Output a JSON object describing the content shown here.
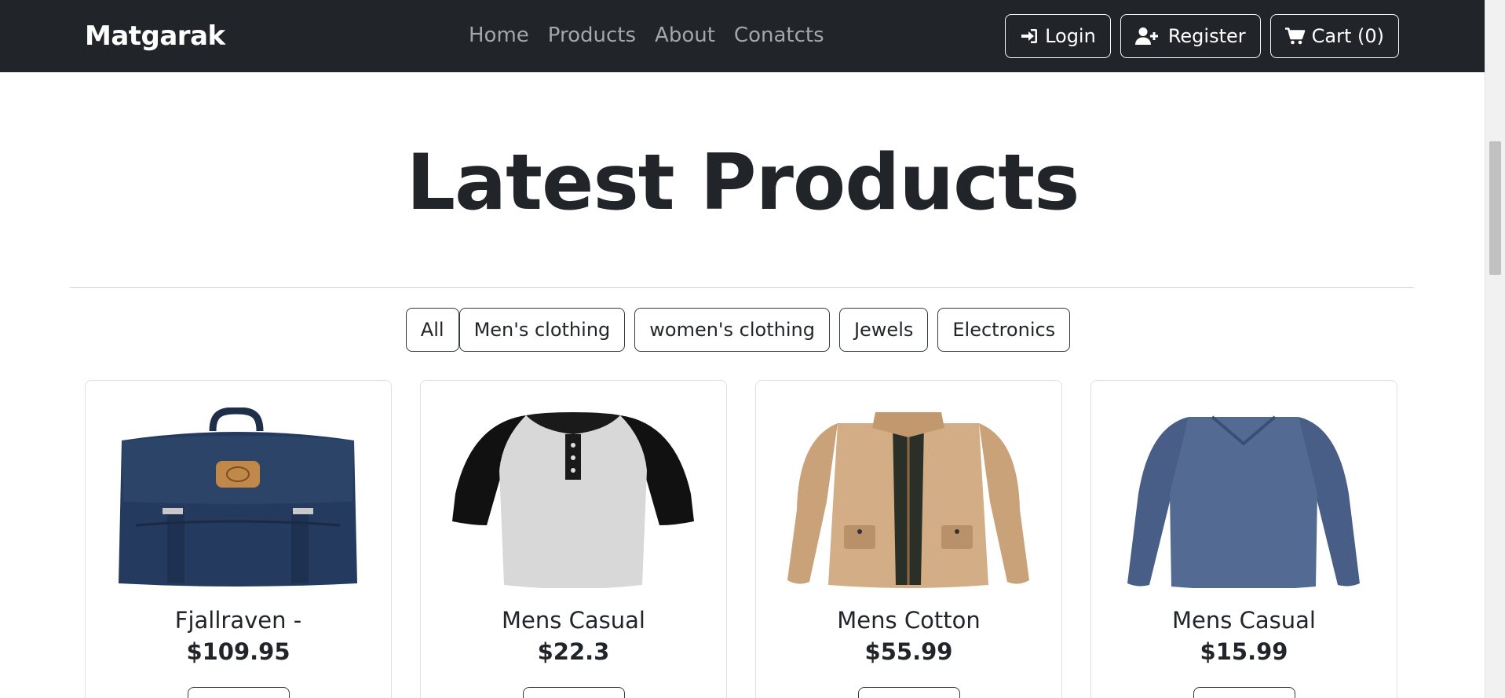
{
  "navbar": {
    "brand": "Matgarak",
    "links": [
      "Home",
      "Products",
      "About",
      "Conatcts"
    ],
    "login_label": "Login",
    "register_label": "Register",
    "cart_label": "Cart (0)"
  },
  "main": {
    "title": "Latest Products",
    "filters": [
      "All",
      "Men's clothing",
      "women's clothing",
      "Jewels",
      "Electronics"
    ],
    "products": [
      {
        "title": "Fjallraven -",
        "price": "$109.95",
        "image": "backpack"
      },
      {
        "title": "Mens Casual",
        "price": "$22.3",
        "image": "raglan-tshirt"
      },
      {
        "title": "Mens Cotton",
        "price": "$55.99",
        "image": "jacket"
      },
      {
        "title": "Mens Casual",
        "price": "$15.99",
        "image": "long-sleeve-shirt"
      }
    ]
  },
  "colors": {
    "navbar_bg": "#212529",
    "nav_link": "#a3a7ab",
    "text": "#212529"
  }
}
